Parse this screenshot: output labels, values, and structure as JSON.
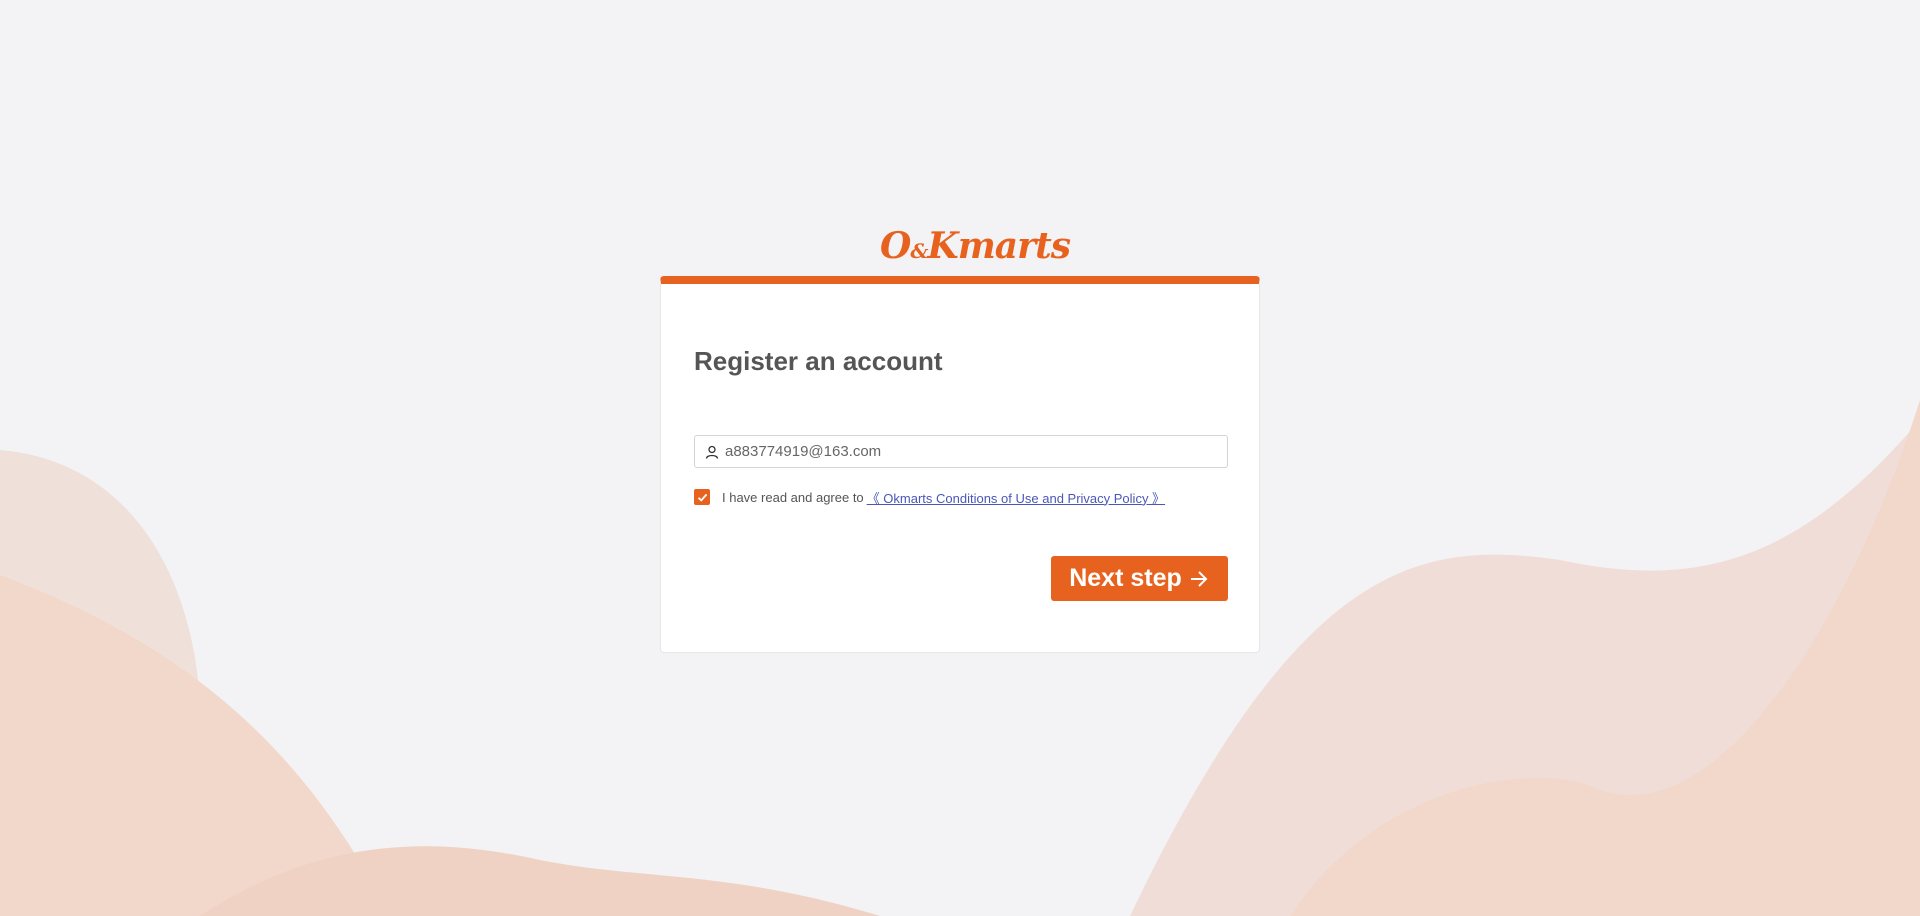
{
  "brand": {
    "logo_primary": "O",
    "logo_amp": "&",
    "logo_k": "K",
    "logo_suffix": "marts",
    "accent_color": "#e8621f"
  },
  "register": {
    "title": "Register an account",
    "email_value": "a883774919@163.com",
    "user_icon": "user-icon",
    "agree_checked": true,
    "agree_text": "I have read and agree to",
    "policy_link": "《 Okmarts Conditions of Use and Privacy Policy 》",
    "next_button_label": "Next step",
    "next_button_icon": "arrow-right-icon"
  }
}
